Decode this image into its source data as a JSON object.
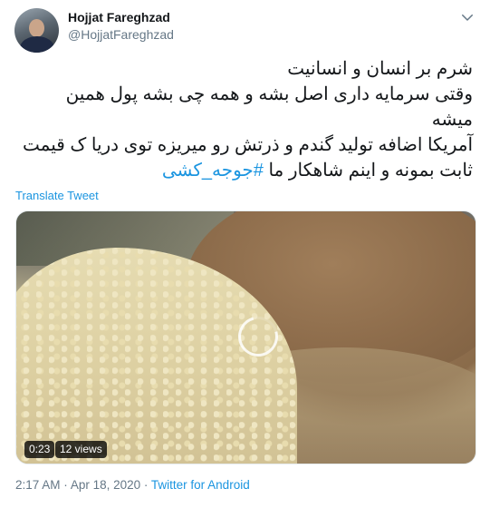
{
  "author": {
    "name": "Hojjat Fareghzad",
    "handle": "@HojjatFareghzad",
    "avatar_icon": "profile-avatar"
  },
  "menu_icon": "chevron-down-icon",
  "tweet": {
    "lines": [
      "شرم بر انسان و انسانیت",
      "وقتی سرمایه داری اصل بشه و همه چی بشه پول همین",
      "میشه",
      "آمریکا اضافه تولید گندم و ذرتش رو میریزه توی دریا ک قیمت"
    ],
    "last_line_text": "ثابت بمونه و اینم شاهکار ما ",
    "hashtag": "#جوجه_کشی",
    "translate_label": "Translate Tweet"
  },
  "media": {
    "type": "video",
    "duration": "0:23",
    "views": "12 views",
    "loading_icon": "loading-spinner-icon"
  },
  "footer": {
    "time": "2:17 AM",
    "separator": "·",
    "date": "Apr 18, 2020",
    "source": "Twitter for Android"
  },
  "colors": {
    "link": "#1b95e0",
    "secondary_text": "#657786",
    "primary_text": "#14171a"
  }
}
